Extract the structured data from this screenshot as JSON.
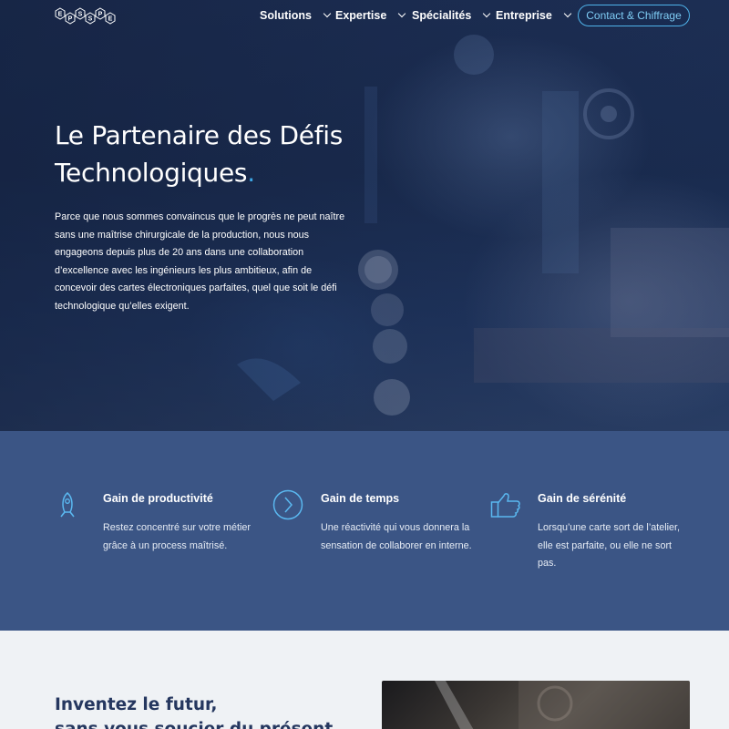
{
  "nav": {
    "logo_letters": [
      "E",
      "P",
      "S",
      "S",
      "P",
      "E"
    ],
    "items": [
      {
        "label": "Solutions"
      },
      {
        "label": "Expertise"
      },
      {
        "label": "Spécialités"
      },
      {
        "label": "Entreprise"
      }
    ],
    "cta_label": "Contact & Chiffrage"
  },
  "hero": {
    "title_line1": "Le Partenaire des Défis",
    "title_line2": "Technologiques",
    "title_dot": ".",
    "paragraph": "Parce que nous sommes convaincus que le progrès ne peut naître sans une maîtrise chirurgicale de la production, nous nous engageons depuis plus de 20 ans dans une collaboration d’excellence avec les ingénieurs les plus ambitieux, afin de concevoir des cartes électroniques parfaites, quel que soit le défi technologique qu’elles exigent."
  },
  "features": [
    {
      "icon": "rocket-icon",
      "title": "Gain de productivité",
      "text": "Restez concentré sur votre métier grâce à un process maîtrisé."
    },
    {
      "icon": "chevron-right-circle-icon",
      "title": "Gain de temps",
      "text": "Une réactivité qui vous donnera la sensation de collaborer en interne."
    },
    {
      "icon": "thumbs-up-icon",
      "title": "Gain de sérénité",
      "text": "Lorsqu’une carte sort de l’atelier, elle est parfaite, ou elle ne sort pas."
    }
  ],
  "bottom": {
    "title_line1": "Inventez le futur,",
    "title_line2": "sans vous soucier du présent."
  },
  "colors": {
    "accent": "#3da7e6",
    "features_bg": "#3b5585",
    "bottom_title": "#25375f",
    "cta_border": "#4fb3ea"
  }
}
